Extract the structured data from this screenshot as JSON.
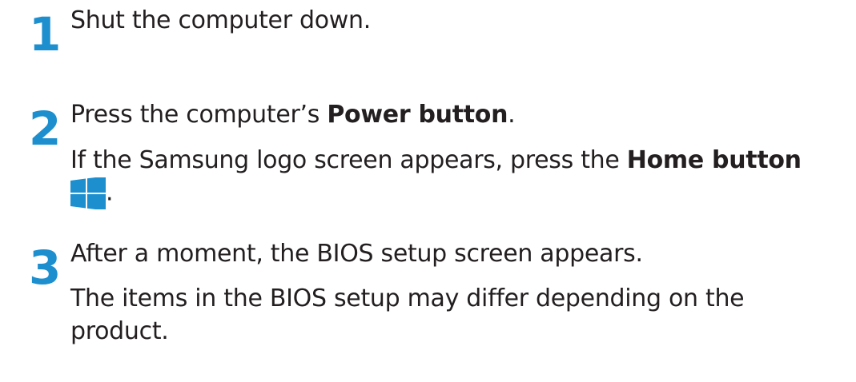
{
  "steps": [
    {
      "number": "1",
      "text": "Shut the computer down."
    },
    {
      "number": "2",
      "text_before": "Press the computer’s ",
      "text_bold": "Power button",
      "text_after": ".",
      "note_before": "If the Samsung logo screen appears, press the ",
      "note_bold": "Home button",
      "note_after": ".",
      "icon": "windows-home-icon"
    },
    {
      "number": "3",
      "text": "After a moment, the BIOS setup screen appears.",
      "note_line1": "The items in the BIOS setup may differ depending on the",
      "note_line2": "product."
    }
  ],
  "colors": {
    "accent": "#1d8fcf",
    "text": "#231f20"
  }
}
